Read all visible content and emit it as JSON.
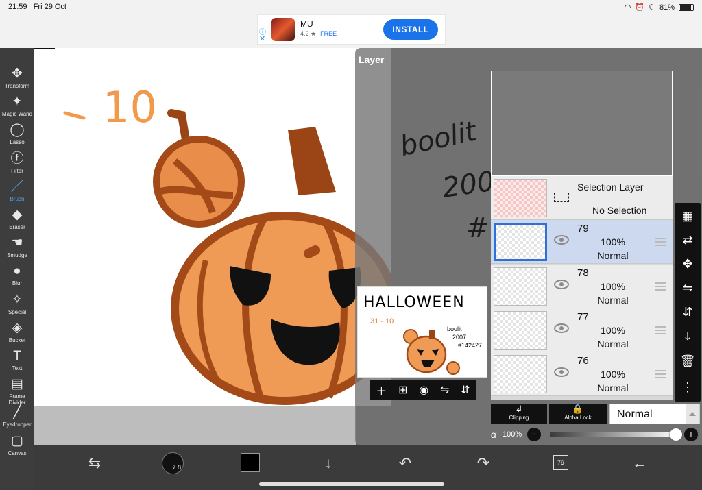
{
  "status_bar": {
    "time": "21:59",
    "date": "Fri 29 Oct",
    "battery": "81%"
  },
  "ad": {
    "app_name": "MU",
    "rating": "4.2 ★",
    "price": "FREE",
    "install_label": "INSTALL"
  },
  "toolbar": {
    "tools": [
      {
        "label": "Transform",
        "icon": "move-arrows-icon"
      },
      {
        "label": "Magic Wand",
        "icon": "magic-wand-icon"
      },
      {
        "label": "Lasso",
        "icon": "lasso-icon"
      },
      {
        "label": "Filter",
        "icon": "fx-icon"
      },
      {
        "label": "Brush",
        "icon": "brush-icon"
      },
      {
        "label": "Eraser",
        "icon": "eraser-icon"
      },
      {
        "label": "Smudge",
        "icon": "smudge-icon"
      },
      {
        "label": "Blur",
        "icon": "drop-icon"
      },
      {
        "label": "Special",
        "icon": "sparkle-icon"
      },
      {
        "label": "Bucket",
        "icon": "bucket-icon"
      },
      {
        "label": "Text",
        "icon": "text-icon"
      },
      {
        "label": "Frame Divider",
        "icon": "frame-divider-icon"
      },
      {
        "label": "Eyedropper",
        "icon": "eyedropper-icon"
      },
      {
        "label": "Canvas",
        "icon": "canvas-icon"
      }
    ],
    "active": "Brush",
    "active_color": "#4fa3f0"
  },
  "canvas": {
    "text_date": "- 10",
    "fx_text": "FX"
  },
  "layer_panel": {
    "title": "Layer",
    "ghost_text": [
      "boolit",
      "2007",
      "#"
    ],
    "thumbnail": {
      "title": "HALLOWEEN",
      "sub": "31 - 10",
      "note": [
        "boolit",
        "2007",
        "#142427"
      ]
    },
    "selection_layer": {
      "name": "Selection Layer",
      "status": "No Selection"
    },
    "layers": [
      {
        "number": "79",
        "opacity": "100%",
        "mode": "Normal",
        "selected": true
      },
      {
        "number": "78",
        "opacity": "100%",
        "mode": "Normal",
        "selected": false
      },
      {
        "number": "77",
        "opacity": "100%",
        "mode": "Normal",
        "selected": false
      },
      {
        "number": "76",
        "opacity": "100%",
        "mode": "Normal",
        "selected": false
      }
    ],
    "clipping_label": "Clipping",
    "alpha_lock_label": "Alpha Lock",
    "blend_mode": "Normal",
    "alpha_symbol": "α",
    "alpha_value": "100%",
    "alpha_fraction": 1.0
  },
  "bottom_bar": {
    "brush_size": "7.8",
    "layer_count": "79"
  },
  "colors": {
    "accent": "#1a73e8",
    "selected_layer": "#2f6fd6",
    "pumpkin": "#ef8a3e"
  }
}
